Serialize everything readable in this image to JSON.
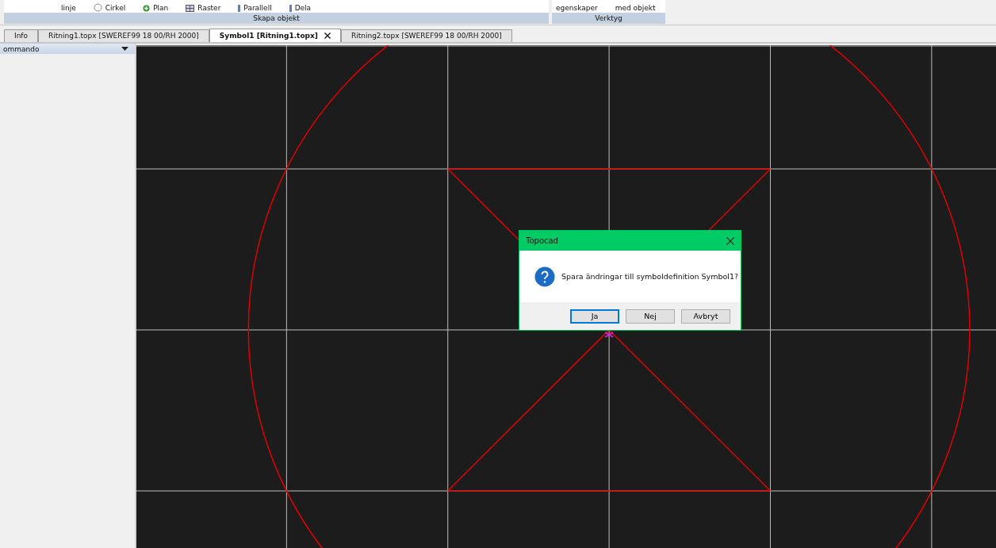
{
  "ribbon": {
    "groups": [
      {
        "label": "Skapa objekt",
        "tools": [
          {
            "label": "linje",
            "kind": "text"
          },
          {
            "label": "Cirkel",
            "kind": "circle"
          },
          {
            "label": "Plan",
            "kind": "plus"
          },
          {
            "label": "Raster",
            "kind": "grid"
          },
          {
            "label": "Parallell",
            "kind": "bar"
          },
          {
            "label": "Dela",
            "kind": "bar"
          }
        ]
      },
      {
        "label": "Verktyg",
        "tools": [
          {
            "label": "egenskaper",
            "kind": "text"
          },
          {
            "label": "med objekt",
            "kind": "text"
          }
        ]
      }
    ]
  },
  "tabs": [
    {
      "label": "Info",
      "selected": false,
      "closable": false
    },
    {
      "label": "Ritning1.topx [SWEREF99 18 00/RH 2000]",
      "selected": false,
      "closable": false
    },
    {
      "label": "Symbol1 [Ritning1.topx]",
      "selected": true,
      "closable": true
    },
    {
      "label": "Ritning2.topx [SWEREF99 18 00/RH 2000]",
      "selected": false,
      "closable": false
    }
  ],
  "side_panel": {
    "title": "ommando"
  },
  "dialog": {
    "title": "Topocad",
    "message": "Spara ändringar till symboldefinition Symbol1?",
    "buttons": [
      {
        "label": "Ja",
        "selected": true
      },
      {
        "label": "Nej",
        "selected": false
      },
      {
        "label": "Avbryt",
        "selected": false
      }
    ]
  }
}
